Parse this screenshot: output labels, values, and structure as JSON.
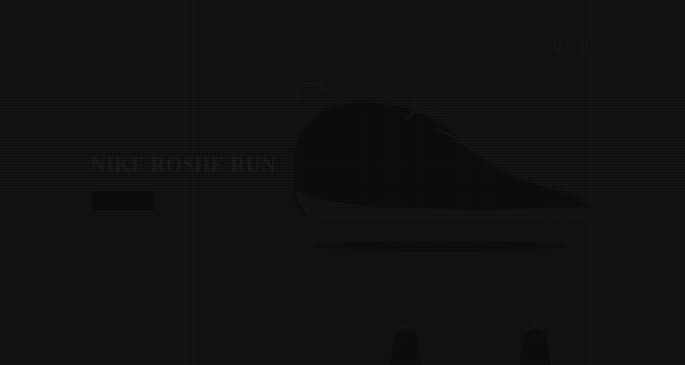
{
  "header": {
    "brand": "",
    "top_link": ""
  },
  "nav": {
    "items": [
      "",
      "",
      "",
      ""
    ]
  },
  "hero": {
    "title": "NIKE ROSHE RUN",
    "button_label": ""
  },
  "products": {
    "section_label": ""
  },
  "colors": {
    "background": "#151515",
    "overlay": "#000000",
    "hero_text": "#212121"
  }
}
